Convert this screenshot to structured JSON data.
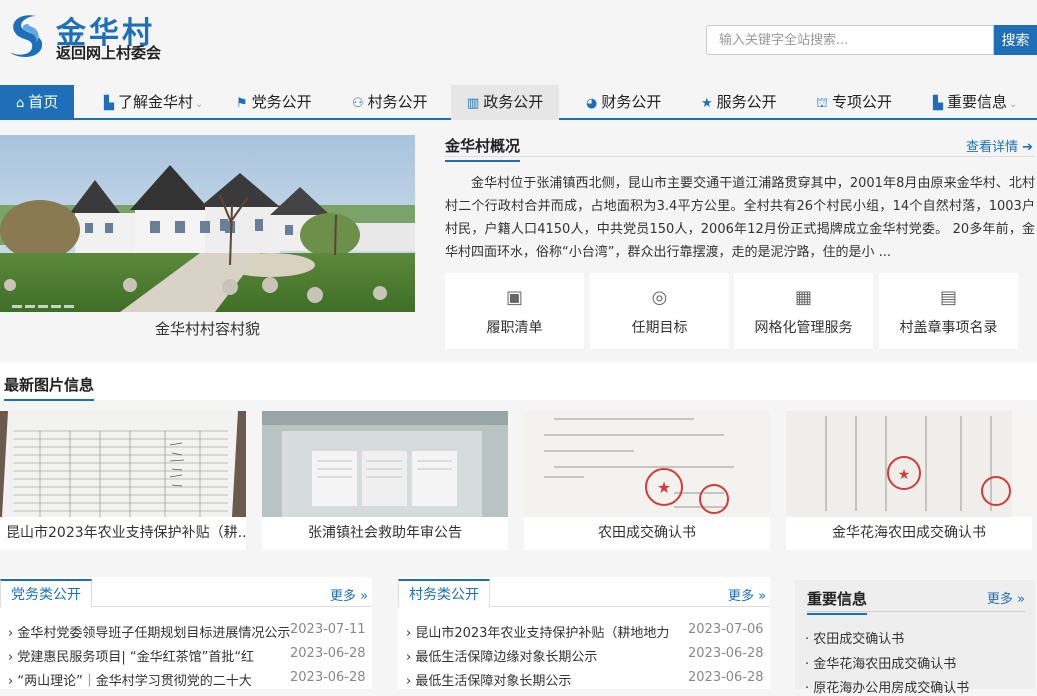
{
  "brand": {
    "title": "金华村",
    "subtitle": "返回网上村委会"
  },
  "search": {
    "placeholder": "输入关键字全站搜索...",
    "button": "搜索"
  },
  "nav": [
    {
      "label": "首页",
      "icon": "home-icon"
    },
    {
      "label": "了解金华村",
      "icon": "building-icon"
    },
    {
      "label": "党务公开",
      "icon": "flag-icon"
    },
    {
      "label": "村务公开",
      "icon": "people-icon"
    },
    {
      "label": "政务公开",
      "icon": "bank-icon"
    },
    {
      "label": "财务公开",
      "icon": "piechart-icon"
    },
    {
      "label": "服务公开",
      "icon": "star-icon"
    },
    {
      "label": "专项公开",
      "icon": "sitemap-icon"
    },
    {
      "label": "重要信息",
      "icon": "bookmark-icon"
    }
  ],
  "hero": {
    "caption": "金华村村容村貌"
  },
  "overview": {
    "title": "金华村概况",
    "more": "查看详情",
    "text": "金华村位于张浦镇西北侧，昆山市主要交通干道江浦路贯穿其中，2001年8月由原来金华村、北村村二个行政村合并而成，占地面积为3.4平方公里。全村共有26个村民小组，14个自然村落，1003户村民，户籍人口4150人，中共党员150人，2006年12月份正式揭牌成立金华村党委。 20多年前，金华村四面环水，俗称“小台湾”，群众出行靠摆渡，走的是泥泞路，住的是小 ..."
  },
  "services": [
    {
      "label": "履职清单",
      "icon": "id-card-icon"
    },
    {
      "label": "任期目标",
      "icon": "target-icon"
    },
    {
      "label": "网格化管理服务",
      "icon": "grid-icon"
    },
    {
      "label": "村盖章事项名录",
      "icon": "document-list-icon"
    }
  ],
  "pictures": {
    "title": "最新图片信息",
    "items": [
      {
        "caption": "昆山市2023年农业支持保护补贴（耕..."
      },
      {
        "caption": "张浦镇社会救助年审公告"
      },
      {
        "caption": "农田成交确认书"
      },
      {
        "caption": "金华花海农田成交确认书"
      }
    ]
  },
  "party": {
    "tab": "党务类公开",
    "more": "更多",
    "items": [
      {
        "title": "› 金华村党委领导班子任期规划目标进展情况公示",
        "date": "2023-07-11"
      },
      {
        "title": "› 党建惠民服务项目| “金华红茶馆”首批“红",
        "date": "2023-06-28"
      },
      {
        "title": "› “两山理论”｜金华村学习贯彻党的二十大",
        "date": "2023-06-28"
      }
    ]
  },
  "village": {
    "tab": "村务类公开",
    "more": "更多",
    "items": [
      {
        "title": "› 昆山市2023年农业支持保护补贴（耕地地力",
        "date": "2023-07-06"
      },
      {
        "title": "› 最低生活保障边缘对象长期公示",
        "date": "2023-06-28"
      },
      {
        "title": "› 最低生活保障对象长期公示",
        "date": "2023-06-28"
      }
    ]
  },
  "important": {
    "title": "重要信息",
    "more": "更多",
    "items": [
      {
        "title": "· 农田成交确认书"
      },
      {
        "title": "· 金华花海农田成交确认书"
      },
      {
        "title": "· 原花海办公用房成交确认书"
      }
    ]
  }
}
